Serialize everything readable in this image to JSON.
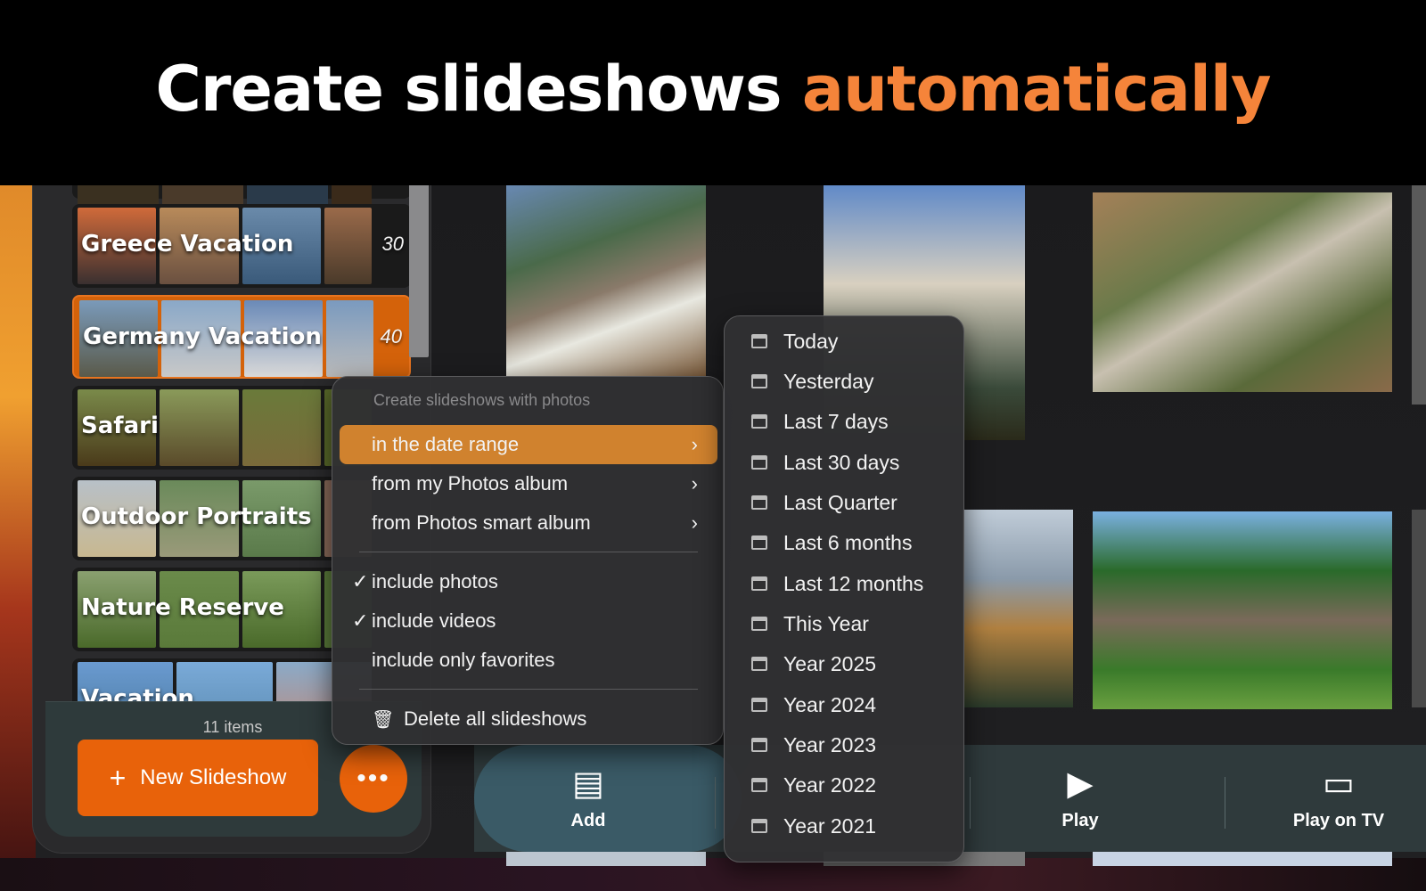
{
  "banner": {
    "text_white": "Create slideshows ",
    "text_accent": "automatically",
    "accent_color": "#f5843a"
  },
  "sidebar": {
    "albums": [
      {
        "title": "",
        "count": ""
      },
      {
        "title": "Greece Vacation",
        "count": "30"
      },
      {
        "title": "Germany Vacation",
        "count": "40",
        "selected": true
      },
      {
        "title": "Safari",
        "count": ""
      },
      {
        "title": "Outdoor Portraits",
        "count": ""
      },
      {
        "title": "Nature Reserve",
        "count": ""
      },
      {
        "title": "Vacation",
        "count": ""
      }
    ],
    "items_count": "11 items",
    "new_button": "New Slideshow",
    "more_button": "•••"
  },
  "menu": {
    "header": "Create slideshows with photos",
    "items": [
      {
        "label": "in the date range",
        "submenu": true,
        "active": true
      },
      {
        "label": "from my Photos album",
        "submenu": true
      },
      {
        "label": "from Photos smart album",
        "submenu": true
      },
      {
        "label": "include photos",
        "checked": true
      },
      {
        "label": "include videos",
        "checked": true
      },
      {
        "label": "include only favorites",
        "checked": false
      },
      {
        "label": "Delete all slideshows",
        "icon": "trash-icon"
      }
    ]
  },
  "date_submenu": {
    "items": [
      "Today",
      "Yesterday",
      "Last 7 days",
      "Last 30 days",
      "Last Quarter",
      "Last 6 months",
      "Last 12 months",
      "This Year",
      "Year 2025",
      "Year 2024",
      "Year 2023",
      "Year 2022",
      "Year 2021"
    ]
  },
  "toolbar": {
    "add": "Add",
    "play": "Play",
    "play_on_tv": "Play on TV"
  },
  "colors": {
    "orange": "#e8620a",
    "menu_highlight": "#d0822e"
  }
}
